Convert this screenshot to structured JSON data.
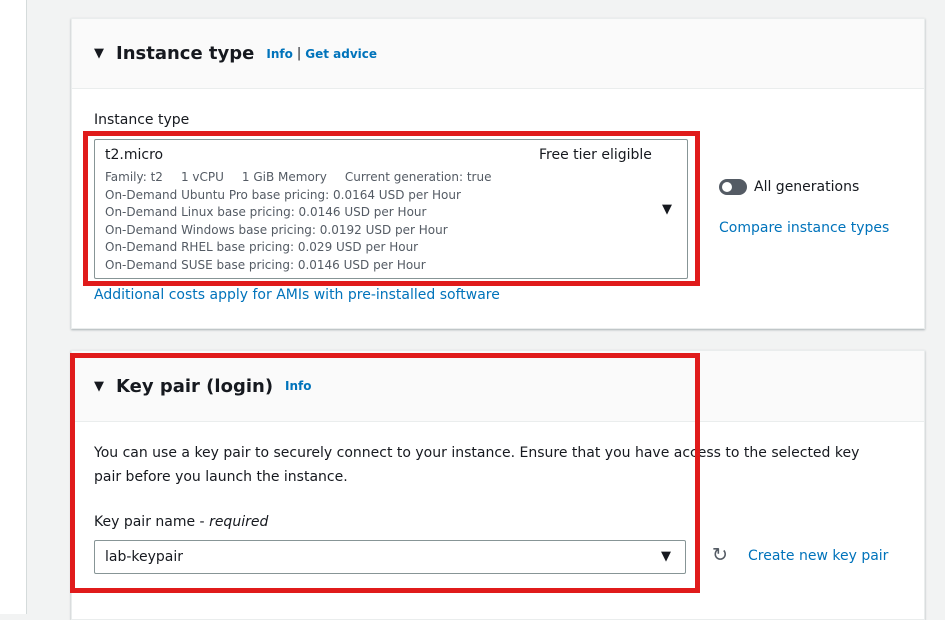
{
  "instance_type": {
    "title": "Instance type",
    "info": "Info",
    "sep": "|",
    "advice": "Get advice",
    "field_label": "Instance type",
    "selected": {
      "name": "t2.micro",
      "badge": "Free tier eligible",
      "details": [
        "Family: t2",
        "1 vCPU",
        "1 GiB Memory",
        "Current generation: true"
      ],
      "pricing": [
        "On-Demand Ubuntu Pro base pricing: 0.0164 USD per Hour",
        "On-Demand Linux base pricing: 0.0146 USD per Hour",
        "On-Demand Windows base pricing: 0.0192 USD per Hour",
        "On-Demand RHEL base pricing: 0.029 USD per Hour",
        "On-Demand SUSE base pricing: 0.0146 USD per Hour"
      ]
    },
    "all_generations": "All generations",
    "all_generations_on": false,
    "compare": "Compare instance types",
    "additional": "Additional costs apply for AMIs with pre-installed software"
  },
  "key_pair": {
    "title": "Key pair (login)",
    "info": "Info",
    "description": "You can use a key pair to securely connect to your instance. Ensure that you have access to the selected key pair before you launch the instance.",
    "field_label": "Key pair name",
    "required": "required",
    "value": "lab-keypair",
    "create": "Create new key pair"
  },
  "highlight_color": "#e01b1b"
}
